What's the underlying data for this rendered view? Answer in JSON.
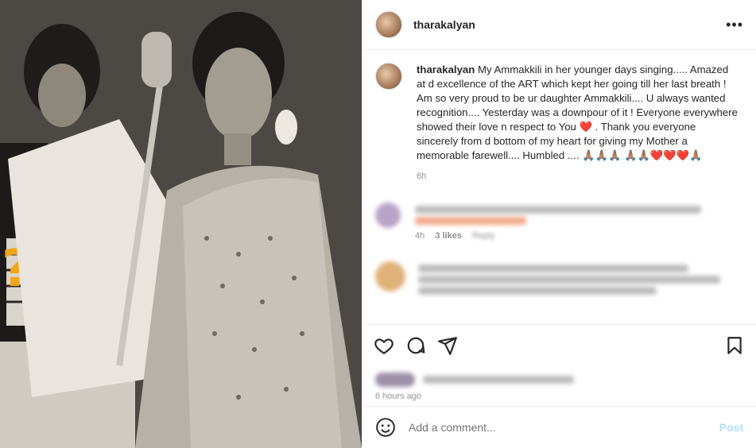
{
  "post": {
    "username": "tharakalyan",
    "more_icon": "more-horizontal-icon"
  },
  "caption": {
    "username": "tharakalyan",
    "text": "My Ammakkili in her younger days singing..... Amazed at d excellence of the ART which kept her going till her last breath ! Am so very proud to be ur daughter Ammakkili.... U always wanted recognition.... Yesterday was a downpour of it ! Everyone everywhere showed their love n respect to You ❤️ . Thank you everyone sincerely from d bottom of my heart for giving my Mother a memorable farewell.... Humbled .... 🙏🏽🙏🏽🙏🏽 🙏🏽🙏🏽❤️❤️❤️🙏🏽",
    "time": "6h"
  },
  "comments": [
    {
      "time": "4h",
      "likes": "3 likes",
      "reply": "Reply"
    }
  ],
  "likes_section": {
    "ago": "6 hours ago"
  },
  "add_comment": {
    "placeholder": "Add a comment...",
    "post_label": "Post"
  },
  "colors": {
    "accent": "#0095f6",
    "post_disabled": "#b2dffc",
    "heart": "#ed4956"
  }
}
